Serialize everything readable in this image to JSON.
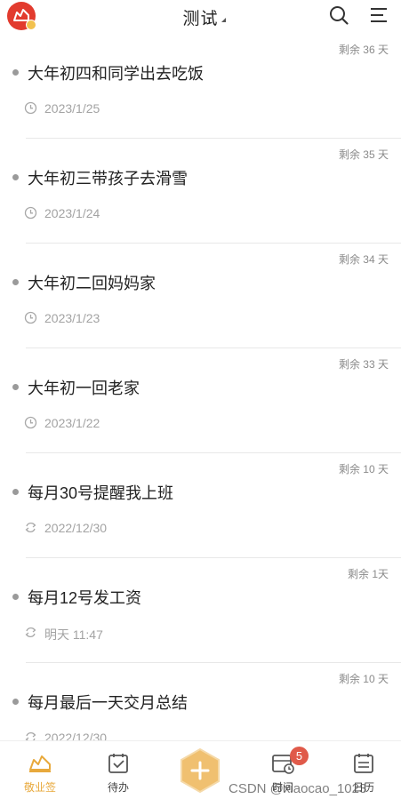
{
  "header": {
    "title": "测试"
  },
  "items": [
    {
      "title": "大年初四和同学出去吃饭",
      "date": "2023/1/25",
      "remaining": "剩余 36 天",
      "icon": "clock-icon"
    },
    {
      "title": "大年初三带孩子去滑雪",
      "date": "2023/1/24",
      "remaining": "剩余 35 天",
      "icon": "clock-icon"
    },
    {
      "title": "大年初二回妈妈家",
      "date": "2023/1/23",
      "remaining": "剩余 34 天",
      "icon": "clock-icon"
    },
    {
      "title": "大年初一回老家",
      "date": "2023/1/22",
      "remaining": "剩余 33 天",
      "icon": "clock-icon"
    },
    {
      "title": "每月30号提醒我上班",
      "date": "2022/12/30",
      "remaining": "剩余 10 天",
      "icon": "repeat-icon"
    },
    {
      "title": "每月12号发工资",
      "date": "明天 11:47",
      "remaining": "剩余 1天",
      "icon": "repeat-icon"
    },
    {
      "title": "每月最后一天交月总结",
      "date": "2022/12/30",
      "remaining": "剩余 10 天",
      "icon": "repeat-icon"
    }
  ],
  "nav": {
    "home": "敬业签",
    "todo": "待办",
    "time": "时间",
    "time_badge": "5",
    "calendar": "日历"
  },
  "watermark": "CSDN @xiaocao_1023",
  "colors": {
    "accent": "#e8a93c",
    "logo": "#e23b2e",
    "badge": "#e05a4a"
  }
}
